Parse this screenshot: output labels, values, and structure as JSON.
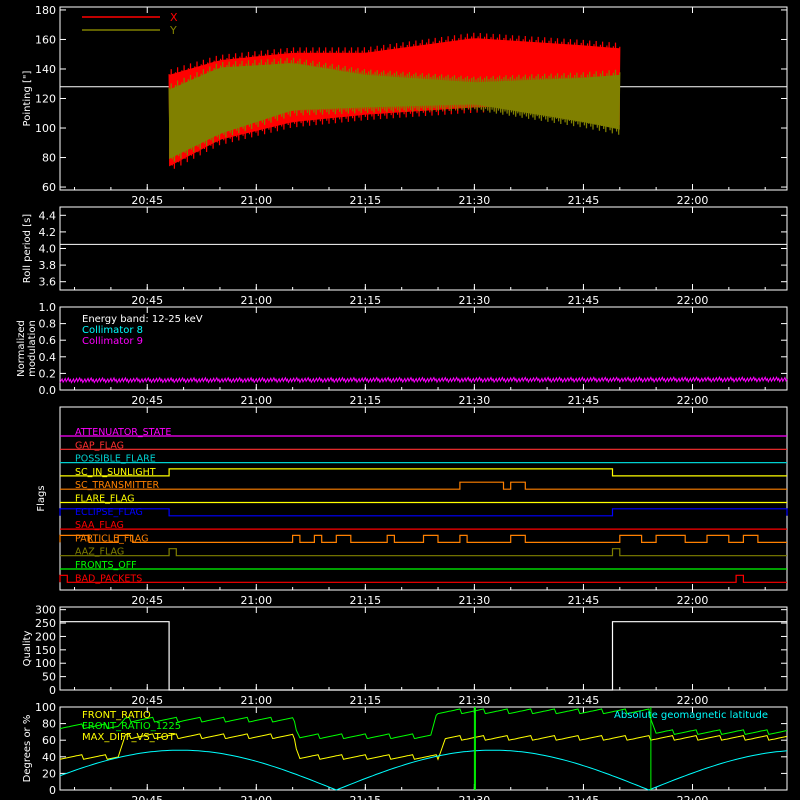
{
  "x_ticks": [
    "20:45",
    "21:00",
    "21:15",
    "21:30",
    "21:45",
    "22:00"
  ],
  "x_range": [
    "20:33",
    "22:13"
  ],
  "colors": {
    "background": "#000000",
    "axes": "#ffffff",
    "x_series": "#ff0000",
    "y_series": "#808000",
    "white": "#ffffff",
    "cyan": "#00ffff",
    "magenta": "#ff00ff",
    "green": "#00ff00",
    "yellow": "#ffff00"
  },
  "chart_data": [
    {
      "type": "line",
      "panel": "pointing",
      "ylabel": "Pointing [\"]",
      "ylim": [
        58,
        182
      ],
      "yticks": [
        "60",
        "80",
        "100",
        "120",
        "140",
        "160",
        "180"
      ],
      "reference_line": 128,
      "series": [
        {
          "name": "X",
          "color": "#ff0000",
          "time": [
            "20:48",
            "20:55",
            "21:05",
            "21:15",
            "21:30",
            "21:45",
            "21:50"
          ],
          "upper": [
            140,
            150,
            155,
            155,
            165,
            160,
            158
          ],
          "lower": [
            70,
            88,
            100,
            105,
            110,
            112,
            98
          ]
        },
        {
          "name": "Y",
          "color": "#808000",
          "time": [
            "20:48",
            "20:55",
            "21:05",
            "21:15",
            "21:30",
            "21:45",
            "21:50"
          ],
          "upper": [
            130,
            145,
            148,
            140,
            135,
            138,
            140
          ],
          "lower": [
            75,
            92,
            108,
            110,
            112,
            100,
            95
          ]
        }
      ]
    },
    {
      "type": "line",
      "panel": "roll",
      "ylabel": "Roll period [s]",
      "ylim": [
        3.5,
        4.5
      ],
      "yticks": [
        "3.6",
        "3.8",
        "4.0",
        "4.2",
        "4.4"
      ],
      "series": [
        {
          "name": "",
          "color": "#ffffff",
          "time": [
            "20:33",
            "22:13"
          ],
          "values": [
            4.05,
            4.05
          ]
        }
      ]
    },
    {
      "type": "line",
      "panel": "modulation",
      "ylabel": "Normalized modulation",
      "ylim": [
        0,
        1
      ],
      "yticks": [
        "0.0",
        "0.2",
        "0.4",
        "0.6",
        "0.8",
        "1.0"
      ],
      "annotations": [
        "Energy band: 12-25 keV",
        "Collimator 8",
        "Collimator 9"
      ],
      "series": [
        {
          "name": "Collimator 9",
          "color": "#ff00ff",
          "time": [
            "20:33",
            "22:13"
          ],
          "values": [
            0.12,
            0.13
          ]
        }
      ]
    },
    {
      "type": "flags",
      "panel": "flags",
      "ylabel": "Flags",
      "flags": [
        {
          "label": "ATTENUATOR_STATE",
          "color": "#ff00ff",
          "on": []
        },
        {
          "label": "GAP_FLAG",
          "color": "#ff3030",
          "on": []
        },
        {
          "label": "POSSIBLE_FLARE",
          "color": "#00d0d0",
          "on": []
        },
        {
          "label": "SC_IN_SUNLIGHT",
          "color": "#ffff00",
          "on": [
            [
              "20:48",
              "21:49"
            ]
          ]
        },
        {
          "label": "SC_TRANSMITTER",
          "color": "#ff8000",
          "on": [
            [
              "21:28",
              "21:34"
            ],
            [
              "21:35",
              "21:37"
            ]
          ]
        },
        {
          "label": "FLARE_FLAG",
          "color": "#ffff00",
          "on": []
        },
        {
          "label": "ECLIPSE_FLAG",
          "color": "#0000ff",
          "on": [
            [
              "20:33",
              "20:48"
            ],
            [
              "21:49",
              "22:13"
            ]
          ]
        },
        {
          "label": "SAA_FLAG",
          "color": "#ff0000",
          "on": []
        },
        {
          "label": "PARTICLE_FLAG",
          "color": "#ff8000",
          "on": [
            [
              "20:33",
              "20:37"
            ],
            [
              "20:41",
              "20:43"
            ],
            [
              "21:05",
              "21:06"
            ],
            [
              "21:08",
              "21:09"
            ],
            [
              "21:11",
              "21:13"
            ],
            [
              "21:18",
              "21:19"
            ],
            [
              "21:23",
              "21:25"
            ],
            [
              "21:28",
              "21:29"
            ],
            [
              "21:35",
              "21:37"
            ],
            [
              "21:50",
              "21:53"
            ],
            [
              "21:55",
              "21:59"
            ],
            [
              "22:02",
              "22:05"
            ],
            [
              "22:07",
              "22:09"
            ]
          ]
        },
        {
          "label": "AAZ_FLAG",
          "color": "#808000",
          "on": [
            [
              "20:48",
              "20:49"
            ],
            [
              "21:49",
              "21:50"
            ]
          ]
        },
        {
          "label": "FRONTS_OFF",
          "color": "#00ff00",
          "on": []
        },
        {
          "label": "BAD_PACKETS",
          "color": "#ff0000",
          "on": [
            [
              "20:33",
              "20:34"
            ],
            [
              "22:06",
              "22:07"
            ]
          ]
        }
      ]
    },
    {
      "type": "line",
      "panel": "quality",
      "ylabel": "Quality",
      "ylim": [
        0,
        310
      ],
      "yticks": [
        "0",
        "50",
        "100",
        "150",
        "200",
        "250",
        "300"
      ],
      "series": [
        {
          "name": "",
          "color": "#ffffff",
          "time": [
            "20:33",
            "20:48",
            "20:48",
            "21:49",
            "21:49",
            "22:13"
          ],
          "values": [
            255,
            255,
            0,
            0,
            255,
            255
          ]
        }
      ]
    },
    {
      "type": "line",
      "panel": "geo",
      "ylabel": "Degrees or %",
      "ylim": [
        0,
        100
      ],
      "yticks": [
        "0",
        "20",
        "40",
        "60",
        "80",
        "100"
      ],
      "series": [
        {
          "name": "FRONT_RATIO",
          "color": "#ffff00",
          "time": [
            "20:33",
            "20:41",
            "20:42",
            "21:05",
            "21:06",
            "21:25",
            "21:26",
            "22:13"
          ],
          "values": [
            40,
            40,
            65,
            65,
            40,
            40,
            63,
            63
          ]
        },
        {
          "name": "FRONT_RATIO_1225",
          "color": "#00ff00",
          "time": [
            "20:33",
            "20:41",
            "20:42",
            "21:05",
            "21:06",
            "21:24",
            "21:25",
            "21:54",
            "21:55",
            "22:13"
          ],
          "values": [
            77,
            77,
            85,
            85,
            65,
            65,
            95,
            95,
            70,
            70
          ]
        },
        {
          "name": "MAX_DIFF_VS_TOT",
          "color": "#ffff00",
          "time": [],
          "values": []
        },
        {
          "name": "Absolute geomagnetic latitude",
          "color": "#00ffff",
          "time": [
            "20:33",
            "20:49",
            "21:11",
            "21:30",
            "21:52",
            "22:13"
          ],
          "values": [
            5,
            48,
            0,
            47,
            0,
            35
          ]
        }
      ]
    }
  ]
}
